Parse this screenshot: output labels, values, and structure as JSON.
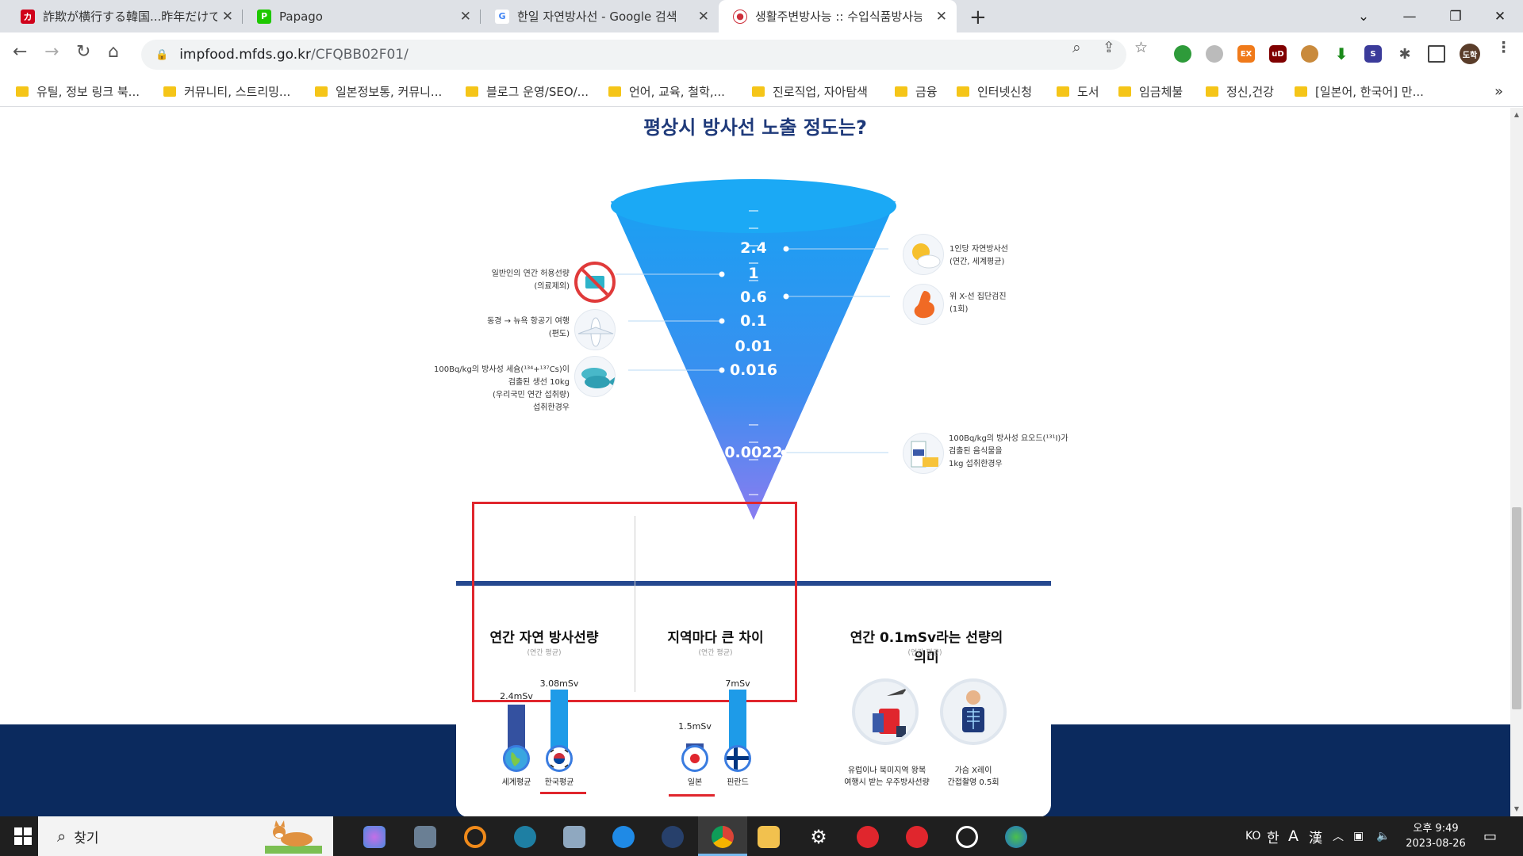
{
  "browser": {
    "tabs": [
      {
        "title": "詐欺が横行する韓国...昨年だけで",
        "favicon_text": "カ",
        "favicon_color": "#d0021b"
      },
      {
        "title": "Papago",
        "favicon_text": "P",
        "favicon_color": "#1ec800"
      },
      {
        "title": "한일 자연방사선 - Google 검색",
        "favicon_text": "G",
        "favicon_color": "#4285f4"
      },
      {
        "title": "생활주변방사능 :: 수입식품방사능",
        "favicon_text": "●",
        "favicon_color": "#cd2e3a"
      }
    ],
    "url_host": "impfood.mfds.go.kr",
    "url_path": "/CFQBB02F01/",
    "ext_labels": {
      "ex": "EX",
      "ud": "uD",
      "s": "S"
    },
    "profile": "도학",
    "bookmarks": [
      "유틸, 정보 링크 북...",
      "커뮤니티, 스트리밍...",
      "일본정보통, 커뮤니...",
      "블로그 운영/SEO/...",
      "언어, 교육, 철학,...",
      "진로직업, 자아탐색",
      "금융",
      "인터넷신청",
      "도서",
      "임금체불",
      "정신,건강",
      "[일본어, 한국어] 만..."
    ]
  },
  "page": {
    "heading": "평상시 방사선 노출 정도는?",
    "funnel_values": [
      "2.4",
      "1",
      "0.6",
      "0.1",
      "0.01",
      "0.016",
      "0.0022"
    ],
    "left_labels": {
      "public_limit": [
        "일반인의 연간 허용선량",
        "(의료제외)"
      ],
      "flight": [
        "동경 → 뉴욕 항공기 여행",
        "(편도)"
      ],
      "fish": [
        "100Bq/kg의 방사성 세슘(¹³⁴+¹³⁷Cs)이",
        "검출된 생선 10kg",
        "(우리국민 연간 섭취량)",
        "섭취한경우"
      ]
    },
    "right_labels": {
      "natural": [
        "1인당 자연방사선",
        "(연간, 세계평균)"
      ],
      "xray": [
        "위 X-선 집단검진",
        "(1회)"
      ],
      "iodine": [
        "100Bq/kg의 방사성 요오드(¹³¹I)가",
        "검출된 음식물을",
        "1kg 섭취한경우"
      ]
    },
    "section1": {
      "title": "연간 자연 방사선량",
      "subtitle": "(연간 평균)",
      "bars": [
        {
          "value_label": "2.4mSv",
          "value": 2.4,
          "caption": "세계평균",
          "color": "#3451a0"
        },
        {
          "value_label": "3.08mSv",
          "value": 3.08,
          "caption": "한국평균",
          "color": "#1e9be8"
        }
      ]
    },
    "section2": {
      "title": "지역마다 큰 차이",
      "subtitle": "(연간 평균)",
      "bars": [
        {
          "value_label": "1.5mSv",
          "value": 1.5,
          "caption": "일본",
          "color": "#3451a0"
        },
        {
          "value_label": "7mSv",
          "value": 7,
          "caption": "핀란드",
          "color": "#1e9be8"
        }
      ]
    },
    "section3": {
      "title": "연간 0.1mSv라는 선량의 의미",
      "subtitle": "(연간 평균)",
      "items": [
        {
          "caption": [
            "유럽이나 북미지역 왕복",
            "여행시 받는 우주방사선량"
          ]
        },
        {
          "caption": [
            "가슴 X레이",
            "간접촬영 0.5회"
          ]
        }
      ]
    }
  },
  "taskbar": {
    "search_text": "찾기",
    "ime": [
      "KO",
      "한",
      "A",
      "漢"
    ],
    "time": "오후 9:49",
    "date": "2023-08-26"
  },
  "colors": {
    "heading": "#1f3a7a",
    "funnel_top": "#1a9bf0",
    "funnel_bottom": "#7b78f0",
    "highlight": "#e0262d",
    "navy": "#0b2a5e"
  }
}
